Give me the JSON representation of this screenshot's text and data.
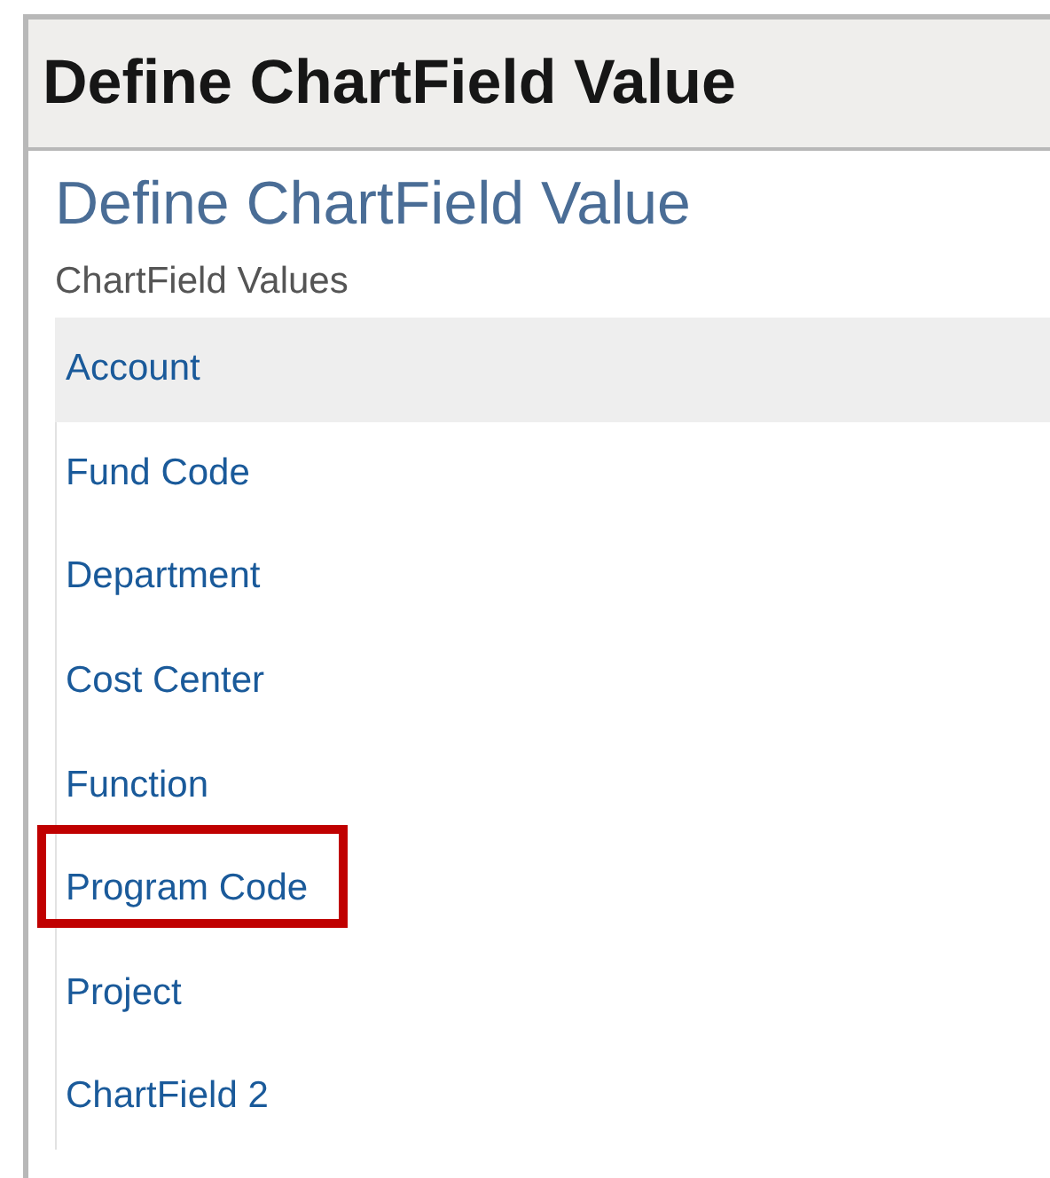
{
  "window": {
    "title": "Define ChartField Value"
  },
  "page": {
    "heading": "Define ChartField Value",
    "list_label": "ChartField Values"
  },
  "items": [
    {
      "label": "Account",
      "selected": true,
      "highlighted": false
    },
    {
      "label": "Fund Code",
      "selected": false,
      "highlighted": false
    },
    {
      "label": "Department",
      "selected": false,
      "highlighted": false
    },
    {
      "label": "Cost Center",
      "selected": false,
      "highlighted": false
    },
    {
      "label": "Function",
      "selected": false,
      "highlighted": false
    },
    {
      "label": "Program Code",
      "selected": false,
      "highlighted": true
    },
    {
      "label": "Project",
      "selected": false,
      "highlighted": false
    },
    {
      "label": "ChartField 2",
      "selected": false,
      "highlighted": false
    }
  ]
}
